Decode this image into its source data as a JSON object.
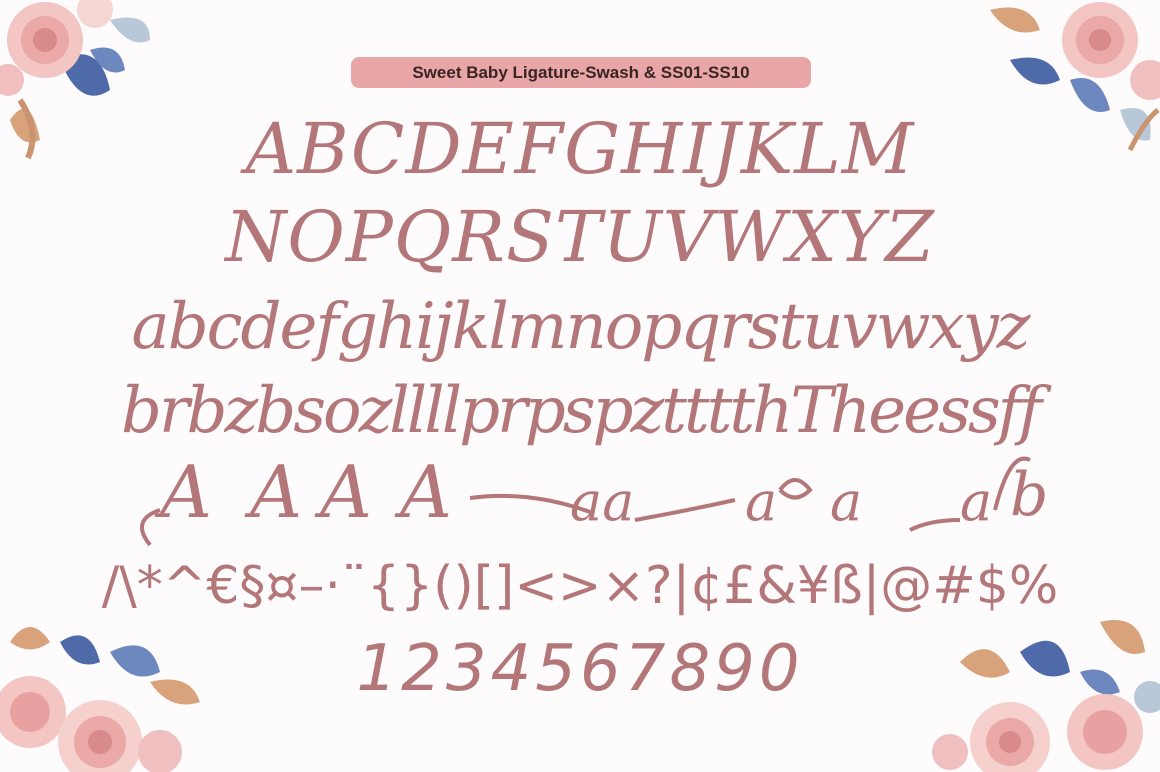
{
  "title": "Sweet Baby Ligature-Swash & SS01-SS10",
  "rows": {
    "uppercase_1": "ABCDEFGHIJKLM",
    "uppercase_2": "NOPQRSTUVWXYZ",
    "lowercase": "abcdefghijklmnopqrstuvwxyz",
    "ligatures": "brbzbsozllllprpspztttthTheessff",
    "symbols": "/\\*^€§¤–·¨{}()[]<>×?|¢£&¥ß|@#$%",
    "numbers": "1234567890"
  },
  "swash_glyphs": {
    "a1": "A",
    "a2": "A",
    "a3": "A",
    "a4": "A",
    "aa": "aa",
    "a5": "a",
    "a6": "a",
    "a7": "a",
    "b": "b"
  },
  "colors": {
    "glyph": "#b37679",
    "badge_bg": "#e9a6a6",
    "badge_text": "#3a2426",
    "background": "#fdfbfb"
  },
  "decorations": [
    "floral-top-left",
    "floral-top-right",
    "floral-bottom-left",
    "floral-bottom-right"
  ]
}
